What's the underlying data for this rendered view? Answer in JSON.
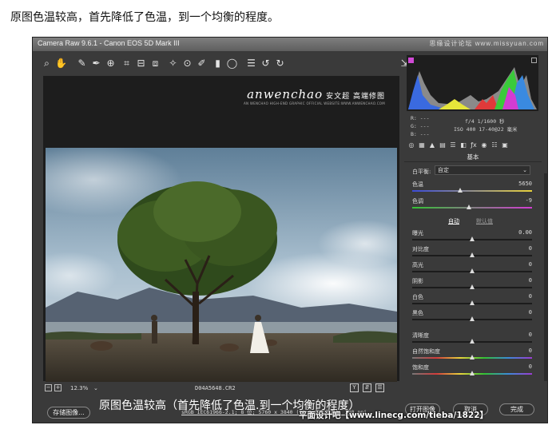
{
  "caption": "原图色温较高，首先降低了色温，到一个均衡的程度。",
  "window": {
    "title": "Camera Raw 9.6.1 - Canon EOS 5D Mark III",
    "top_watermark": "思缘设计论坛 www.missyuan.com"
  },
  "toolbar": {
    "tools": [
      {
        "name": "zoom-tool-icon",
        "glyph": "⌕"
      },
      {
        "name": "hand-tool-icon",
        "glyph": "✋"
      },
      {
        "name": "white-balance-tool-icon",
        "glyph": "✎"
      },
      {
        "name": "color-sampler-icon",
        "glyph": "✒"
      },
      {
        "name": "targeted-adjustment-icon",
        "glyph": "⊕"
      },
      {
        "name": "crop-tool-icon",
        "glyph": "⌗"
      },
      {
        "name": "straighten-tool-icon",
        "glyph": "⊟"
      },
      {
        "name": "transform-tool-icon",
        "glyph": "⧈"
      },
      {
        "name": "spot-removal-icon",
        "glyph": "✧"
      },
      {
        "name": "red-eye-icon",
        "glyph": "⊙"
      },
      {
        "name": "adjustment-brush-icon",
        "glyph": "✐"
      },
      {
        "name": "graduated-filter-icon",
        "glyph": "▮"
      },
      {
        "name": "radial-filter-icon",
        "glyph": "◯"
      },
      {
        "name": "preferences-icon",
        "glyph": "☰"
      },
      {
        "name": "rotate-left-icon",
        "glyph": "↺"
      },
      {
        "name": "rotate-right-icon",
        "glyph": "↻"
      }
    ],
    "export_glyph": "⇲"
  },
  "brand": {
    "name": "anwenchao",
    "cn": "安文超 高端修图",
    "sub": "AN WENCHAO HIGH-END GRAPHIC OFFICIAL WEBSITE:WWW.ANWENCHAO.COM"
  },
  "photo_caption": "原图色温较高（首先降低了色温.到一个均衡的程度）",
  "status": {
    "zoom": "12.3%",
    "zoom_arrow": "⌄",
    "filename": "D04A5648.CR2",
    "view_buttons": [
      "Y",
      "⇵",
      "☰"
    ]
  },
  "bottom": {
    "save_label": "存储图像...",
    "workflow": "sRGB IEC61966-2.1; 8 位; 5760 x 3840 (22.1 百万像素); 300 ppi",
    "open_label": "打开图像",
    "cancel_label": "取消",
    "done_label": "完成",
    "watermark": "平面设计吧【www.linecg.com/tieba/1822】"
  },
  "readout": {
    "r": "R:  ---",
    "g": "G:  ---",
    "b": "B:  ---",
    "camera_line1": "f/4   1/1600 秒",
    "camera_line2": "ISO 400   17-40@22 毫米"
  },
  "panel": {
    "section_title": "基本",
    "wb_label": "白平衡:",
    "wb_value": "自定",
    "auto": "自动",
    "default": "默认值",
    "tabs": [
      "◎",
      "▦",
      "▲",
      "▤",
      "☰",
      "◧",
      "ƒx",
      "◉",
      "☷",
      "▣"
    ],
    "sliders": [
      {
        "id": "temp",
        "label": "色温",
        "value": "5650",
        "pos": 0.4,
        "track": "linear-gradient(90deg,#3b4bd8,#e8d23c)"
      },
      {
        "id": "tint",
        "label": "色调",
        "value": "-9",
        "pos": 0.47,
        "track": "linear-gradient(90deg,#33c233,#d23cd2)"
      },
      {
        "id": "exposure",
        "label": "曝光",
        "value": "0.00",
        "pos": 0.5,
        "track": ""
      },
      {
        "id": "contrast",
        "label": "对比度",
        "value": "0",
        "pos": 0.5,
        "track": ""
      },
      {
        "id": "highlights",
        "label": "高光",
        "value": "0",
        "pos": 0.5,
        "track": ""
      },
      {
        "id": "shadows",
        "label": "阴影",
        "value": "0",
        "pos": 0.5,
        "track": ""
      },
      {
        "id": "whites",
        "label": "白色",
        "value": "0",
        "pos": 0.5,
        "track": ""
      },
      {
        "id": "blacks",
        "label": "黑色",
        "value": "0",
        "pos": 0.5,
        "track": ""
      },
      {
        "id": "clarity",
        "label": "清晰度",
        "value": "0",
        "pos": 0.5,
        "track": ""
      },
      {
        "id": "vibrance",
        "label": "自然饱和度",
        "value": "0",
        "pos": 0.5,
        "track": "linear-gradient(90deg,#777,#d23c3c,#e8d23c,#33c233,#3b8bd8,#9b3cd2)"
      },
      {
        "id": "saturation",
        "label": "饱和度",
        "value": "0",
        "pos": 0.5,
        "track": "linear-gradient(90deg,#777,#d23c3c,#e8d23c,#33c233,#3b8bd8,#9b3cd2)"
      }
    ]
  }
}
